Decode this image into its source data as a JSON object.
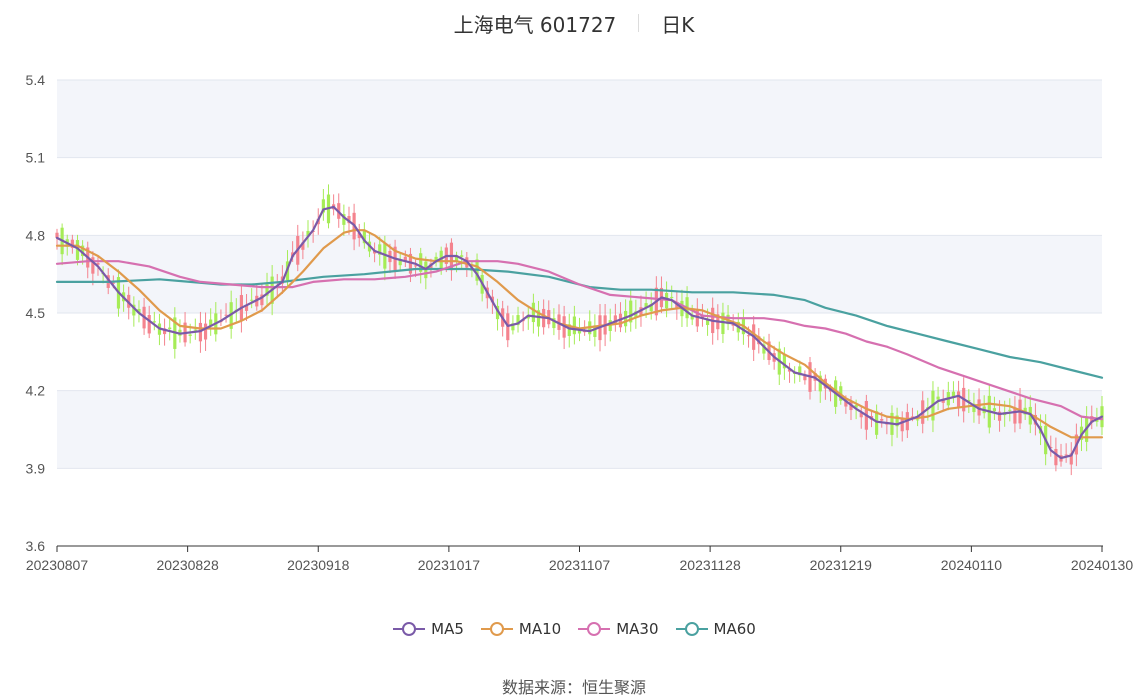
{
  "header": {
    "title": "上海电气 601727",
    "period": "日K"
  },
  "source": {
    "label": "数据来源：",
    "value": "恒生聚源"
  },
  "colors": {
    "up": "#f4838e",
    "down": "#a6ec57",
    "MA5": "#7a5aa8",
    "MA10": "#e09a4c",
    "MA30": "#d670b0",
    "MA60": "#4aa1a0",
    "band": "#f3f5fa",
    "grid": "#e2e6ef"
  },
  "chart_data": {
    "type": "candlestick",
    "ylim": [
      3.6,
      5.4
    ],
    "yticks": [
      "3.6",
      "3.9",
      "4.2",
      "4.5",
      "4.8",
      "5.1",
      "5.4"
    ],
    "xticks": [
      "20230807",
      "20230828",
      "20230918",
      "20231017",
      "20231107",
      "20231128",
      "20231219",
      "20240110",
      "20240130"
    ],
    "x_range": [
      "20230807",
      "20240130"
    ],
    "legend": [
      "MA5",
      "MA10",
      "MA30",
      "MA60"
    ],
    "legend_position": "bottom",
    "ma": {
      "MA5": [
        [
          0,
          4.79
        ],
        [
          4,
          4.75
        ],
        [
          8,
          4.68
        ],
        [
          12,
          4.58
        ],
        [
          16,
          4.5
        ],
        [
          20,
          4.44
        ],
        [
          24,
          4.42
        ],
        [
          28,
          4.43
        ],
        [
          32,
          4.47
        ],
        [
          36,
          4.52
        ],
        [
          40,
          4.56
        ],
        [
          44,
          4.62
        ],
        [
          46,
          4.72
        ],
        [
          48,
          4.77
        ],
        [
          50,
          4.82
        ],
        [
          52,
          4.9
        ],
        [
          54,
          4.91
        ],
        [
          56,
          4.87
        ],
        [
          58,
          4.84
        ],
        [
          60,
          4.78
        ],
        [
          62,
          4.74
        ],
        [
          66,
          4.71
        ],
        [
          70,
          4.69
        ],
        [
          72,
          4.67
        ],
        [
          74,
          4.7
        ],
        [
          76,
          4.72
        ],
        [
          78,
          4.72
        ],
        [
          80,
          4.7
        ],
        [
          82,
          4.65
        ],
        [
          84,
          4.58
        ],
        [
          86,
          4.51
        ],
        [
          88,
          4.45
        ],
        [
          90,
          4.46
        ],
        [
          92,
          4.49
        ],
        [
          96,
          4.48
        ],
        [
          100,
          4.44
        ],
        [
          104,
          4.43
        ],
        [
          108,
          4.46
        ],
        [
          112,
          4.49
        ],
        [
          116,
          4.53
        ],
        [
          118,
          4.56
        ],
        [
          120,
          4.55
        ],
        [
          124,
          4.49
        ],
        [
          128,
          4.47
        ],
        [
          132,
          4.46
        ],
        [
          136,
          4.41
        ],
        [
          140,
          4.33
        ],
        [
          144,
          4.27
        ],
        [
          148,
          4.25
        ],
        [
          152,
          4.19
        ],
        [
          156,
          4.13
        ],
        [
          160,
          4.08
        ],
        [
          164,
          4.07
        ],
        [
          168,
          4.1
        ],
        [
          172,
          4.16
        ],
        [
          176,
          4.18
        ],
        [
          180,
          4.13
        ],
        [
          184,
          4.11
        ],
        [
          188,
          4.12
        ],
        [
          190,
          4.11
        ],
        [
          192,
          4.05
        ],
        [
          194,
          3.97
        ],
        [
          196,
          3.94
        ],
        [
          198,
          3.95
        ],
        [
          200,
          4.03
        ],
        [
          202,
          4.08
        ],
        [
          204,
          4.1
        ]
      ],
      "MA10": [
        [
          0,
          4.76
        ],
        [
          4,
          4.76
        ],
        [
          8,
          4.72
        ],
        [
          12,
          4.66
        ],
        [
          16,
          4.59
        ],
        [
          20,
          4.51
        ],
        [
          24,
          4.45
        ],
        [
          28,
          4.44
        ],
        [
          32,
          4.44
        ],
        [
          36,
          4.47
        ],
        [
          40,
          4.51
        ],
        [
          44,
          4.58
        ],
        [
          48,
          4.66
        ],
        [
          52,
          4.75
        ],
        [
          56,
          4.81
        ],
        [
          58,
          4.82
        ],
        [
          60,
          4.82
        ],
        [
          62,
          4.8
        ],
        [
          66,
          4.74
        ],
        [
          70,
          4.71
        ],
        [
          74,
          4.7
        ],
        [
          78,
          4.7
        ],
        [
          82,
          4.68
        ],
        [
          86,
          4.62
        ],
        [
          90,
          4.55
        ],
        [
          94,
          4.5
        ],
        [
          98,
          4.46
        ],
        [
          102,
          4.44
        ],
        [
          106,
          4.45
        ],
        [
          110,
          4.46
        ],
        [
          114,
          4.49
        ],
        [
          118,
          4.51
        ],
        [
          122,
          4.52
        ],
        [
          126,
          4.51
        ],
        [
          130,
          4.48
        ],
        [
          134,
          4.45
        ],
        [
          138,
          4.39
        ],
        [
          142,
          4.34
        ],
        [
          146,
          4.3
        ],
        [
          150,
          4.23
        ],
        [
          154,
          4.17
        ],
        [
          158,
          4.13
        ],
        [
          162,
          4.1
        ],
        [
          166,
          4.09
        ],
        [
          170,
          4.1
        ],
        [
          174,
          4.13
        ],
        [
          178,
          4.14
        ],
        [
          182,
          4.15
        ],
        [
          186,
          4.14
        ],
        [
          190,
          4.11
        ],
        [
          194,
          4.06
        ],
        [
          198,
          4.02
        ],
        [
          202,
          4.02
        ],
        [
          204,
          4.02
        ]
      ],
      "MA30": [
        [
          0,
          4.69
        ],
        [
          6,
          4.7
        ],
        [
          12,
          4.7
        ],
        [
          18,
          4.68
        ],
        [
          24,
          4.64
        ],
        [
          28,
          4.62
        ],
        [
          34,
          4.61
        ],
        [
          40,
          4.6
        ],
        [
          46,
          4.6
        ],
        [
          50,
          4.62
        ],
        [
          56,
          4.63
        ],
        [
          62,
          4.63
        ],
        [
          68,
          4.64
        ],
        [
          74,
          4.66
        ],
        [
          80,
          4.7
        ],
        [
          86,
          4.7
        ],
        [
          90,
          4.69
        ],
        [
          96,
          4.66
        ],
        [
          102,
          4.61
        ],
        [
          108,
          4.57
        ],
        [
          114,
          4.56
        ],
        [
          120,
          4.55
        ],
        [
          126,
          4.49
        ],
        [
          132,
          4.48
        ],
        [
          138,
          4.48
        ],
        [
          142,
          4.47
        ],
        [
          146,
          4.45
        ],
        [
          150,
          4.44
        ],
        [
          154,
          4.42
        ],
        [
          158,
          4.39
        ],
        [
          162,
          4.37
        ],
        [
          166,
          4.34
        ],
        [
          172,
          4.29
        ],
        [
          178,
          4.25
        ],
        [
          184,
          4.21
        ],
        [
          190,
          4.17
        ],
        [
          196,
          4.14
        ],
        [
          200,
          4.1
        ],
        [
          204,
          4.09
        ]
      ],
      "MA60": [
        [
          0,
          4.62
        ],
        [
          10,
          4.62
        ],
        [
          20,
          4.63
        ],
        [
          26,
          4.62
        ],
        [
          32,
          4.61
        ],
        [
          38,
          4.61
        ],
        [
          44,
          4.62
        ],
        [
          52,
          4.64
        ],
        [
          60,
          4.65
        ],
        [
          70,
          4.67
        ],
        [
          80,
          4.67
        ],
        [
          88,
          4.66
        ],
        [
          96,
          4.64
        ],
        [
          104,
          4.6
        ],
        [
          110,
          4.59
        ],
        [
          116,
          4.59
        ],
        [
          124,
          4.58
        ],
        [
          132,
          4.58
        ],
        [
          140,
          4.57
        ],
        [
          146,
          4.55
        ],
        [
          150,
          4.52
        ],
        [
          156,
          4.49
        ],
        [
          162,
          4.45
        ],
        [
          168,
          4.42
        ],
        [
          174,
          4.39
        ],
        [
          180,
          4.36
        ],
        [
          186,
          4.33
        ],
        [
          192,
          4.31
        ],
        [
          198,
          4.28
        ],
        [
          204,
          4.25
        ]
      ]
    }
  }
}
